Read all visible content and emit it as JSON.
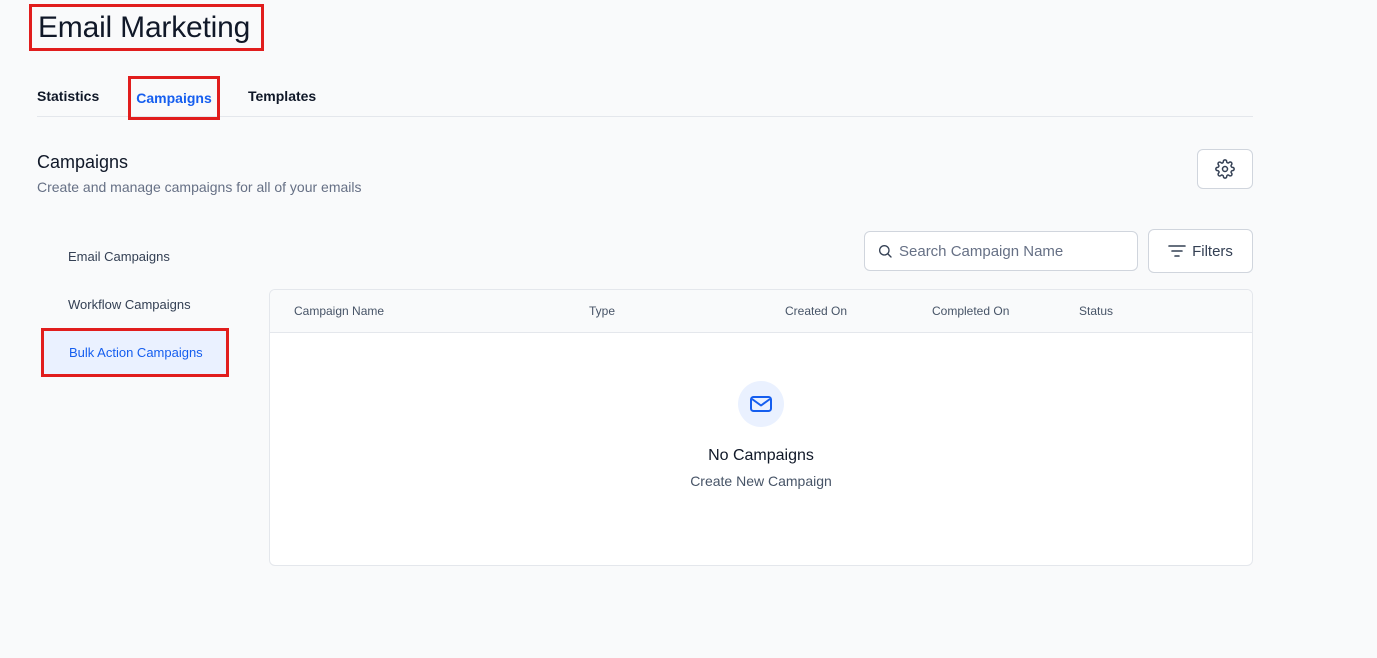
{
  "page": {
    "title": "Email Marketing"
  },
  "tabs": [
    {
      "label": "Statistics",
      "active": false
    },
    {
      "label": "Campaigns",
      "active": true
    },
    {
      "label": "Templates",
      "active": false
    }
  ],
  "section": {
    "title": "Campaigns",
    "subtitle": "Create and manage campaigns for all of your emails",
    "settings_icon": "gear-icon"
  },
  "sidebar": {
    "items": [
      {
        "label": "Email Campaigns",
        "active": false
      },
      {
        "label": "Workflow Campaigns",
        "active": false
      },
      {
        "label": "Bulk Action Campaigns",
        "active": true
      }
    ]
  },
  "toolbar": {
    "search_placeholder": "Search Campaign Name",
    "search_value": "",
    "filters_label": "Filters"
  },
  "table": {
    "columns": [
      "Campaign Name",
      "Type",
      "Created On",
      "Completed On",
      "Status"
    ],
    "rows": []
  },
  "empty_state": {
    "icon": "mail-icon",
    "title": "No Campaigns",
    "subtitle": "Create New Campaign"
  },
  "colors": {
    "accent": "#155eef",
    "highlight_box": "#e11d1d",
    "active_bg": "#eaf1ff"
  }
}
